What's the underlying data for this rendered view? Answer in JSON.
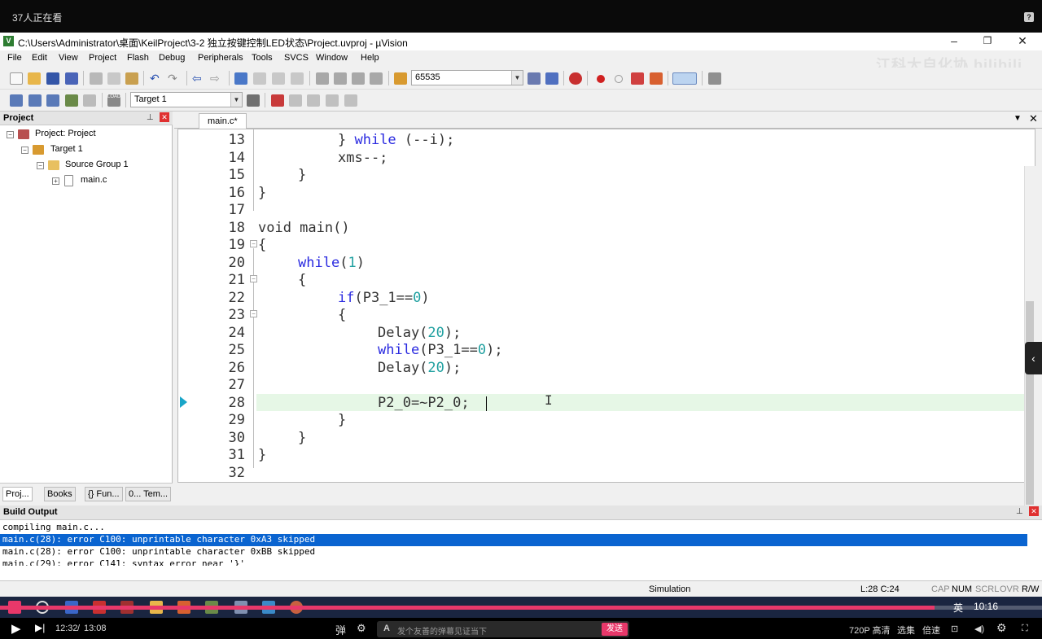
{
  "video": {
    "viewer_count": "37人正在看",
    "help": "?"
  },
  "window": {
    "title": "C:\\Users\\Administrator\\桌面\\KeilProject\\3-2 独立按键控制LED状态\\Project.uvproj - µVision",
    "controls": [
      "–",
      "❐",
      "✕"
    ]
  },
  "menu": [
    "File",
    "Edit",
    "View",
    "Project",
    "Flash",
    "Debug",
    "Peripherals",
    "Tools",
    "SVCS",
    "Window",
    "Help"
  ],
  "watermark": "江科大自化协 bilibili",
  "toolbar": {
    "find_value": "65535",
    "target": "Target 1"
  },
  "project_panel": {
    "title": "Project",
    "tree": [
      {
        "label": "Project: Project",
        "level": 0
      },
      {
        "label": "Target 1",
        "level": 1
      },
      {
        "label": "Source Group 1",
        "level": 2
      },
      {
        "label": "main.c",
        "level": 3
      }
    ],
    "tabs": [
      "Proj...",
      "Books",
      "{} Fun...",
      "0... Tem..."
    ]
  },
  "editor": {
    "tab": "main.c*",
    "lines": [
      {
        "n": "13"
      },
      {
        "n": "14"
      },
      {
        "n": "15"
      },
      {
        "n": "16"
      },
      {
        "n": "17"
      },
      {
        "n": "18"
      },
      {
        "n": "19"
      },
      {
        "n": "20"
      },
      {
        "n": "21"
      },
      {
        "n": "22"
      },
      {
        "n": "23"
      },
      {
        "n": "24"
      },
      {
        "n": "25"
      },
      {
        "n": "26"
      },
      {
        "n": "27"
      },
      {
        "n": "28"
      },
      {
        "n": "29"
      },
      {
        "n": "30"
      },
      {
        "n": "31"
      },
      {
        "n": "32"
      }
    ],
    "code": {
      "l13_a": "} ",
      "l13_kw": "while",
      "l13_b": " (--i);",
      "l14": "xms--;",
      "l15": "}",
      "l16": "}",
      "l18": "void main()",
      "l19": "{",
      "l20_kw": "while",
      "l20_a": "(",
      "l20_num": "1",
      "l20_b": ")",
      "l21": "{",
      "l22_kw": "if",
      "l22_a": "(P3_1==",
      "l22_num": "0",
      "l22_b": ")",
      "l23": "{",
      "l24_a": "Delay(",
      "l24_num": "20",
      "l24_b": ");",
      "l25_kw": "while",
      "l25_a": "(P3_1==",
      "l25_num": "0",
      "l25_b": ");",
      "l26_a": "Delay(",
      "l26_num": "20",
      "l26_b": ");",
      "l28": "P2_0=~P2_0;",
      "l29": "}",
      "l30": "}",
      "l31": "}"
    }
  },
  "build_output": {
    "title": "Build Output",
    "lines": [
      "compiling main.c...",
      "main.c(28): error C100: unprintable character 0xA3 skipped",
      "main.c(28): error C100: unprintable character 0xBB skipped",
      "main.c(29): error C141: syntax error near '}'"
    ]
  },
  "status": {
    "mode": "Simulation",
    "position": "L:28 C:24",
    "flags": [
      "CAP",
      "NUM",
      "SCRL",
      "OVR",
      "R/W"
    ]
  },
  "taskbar": {
    "lang": "英",
    "time": "10:16"
  },
  "player": {
    "current": "12:32",
    "sep": "/",
    "duration": "13:08",
    "progress": 0.897,
    "danmaku_placeholder": "发个友善的弹幕见证当下",
    "send": "发送",
    "quality": "720P 高清",
    "episodes": "选集",
    "speed": "倍速"
  }
}
